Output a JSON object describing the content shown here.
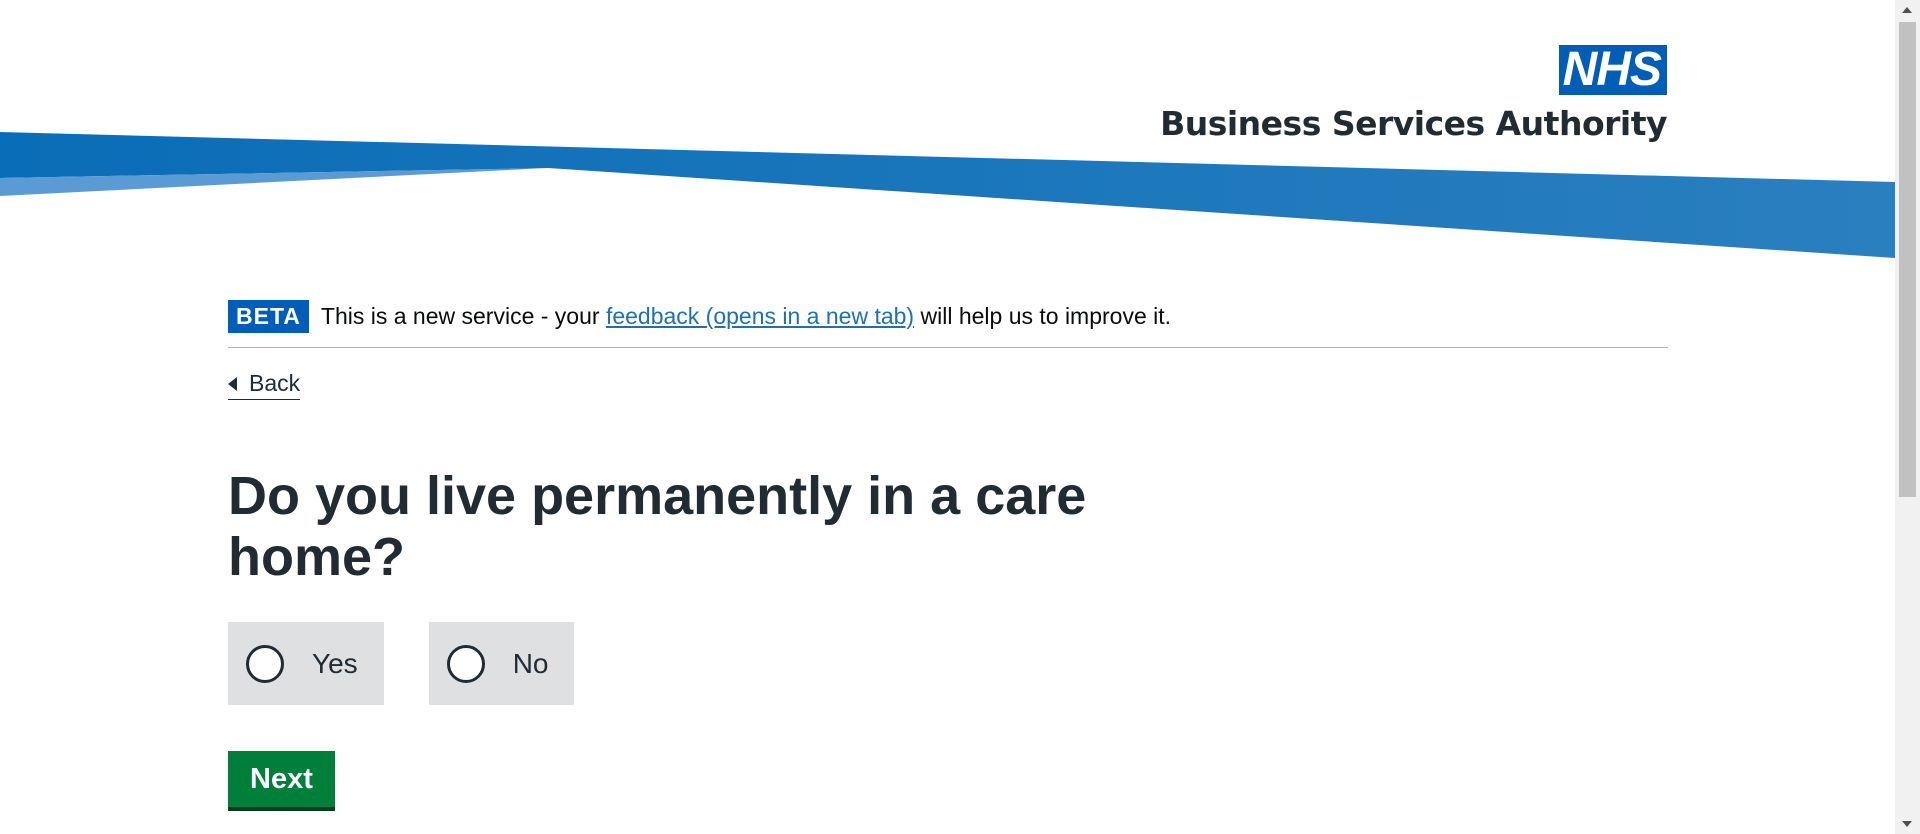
{
  "header": {
    "logo_nhs": "NHS",
    "logo_org": "Business Services Authority",
    "colors": {
      "nhs_blue": "#005eb8",
      "swoosh_dark": "#1273bb",
      "swoosh_light": "#5a9bd5"
    }
  },
  "phase_banner": {
    "tag": "BETA",
    "text_before": "This is a new service - your ",
    "link_text": "feedback (opens in a new tab)",
    "text_after": " will help us to improve it."
  },
  "back_link": {
    "label": "Back",
    "icon": "chevron-left-icon"
  },
  "question": {
    "heading": "Do you live permanently in a care home?"
  },
  "radios": {
    "options": [
      {
        "label": "Yes",
        "selected": false
      },
      {
        "label": "No",
        "selected": false
      }
    ]
  },
  "actions": {
    "next_label": "Next",
    "next_color": "#007f3b"
  }
}
